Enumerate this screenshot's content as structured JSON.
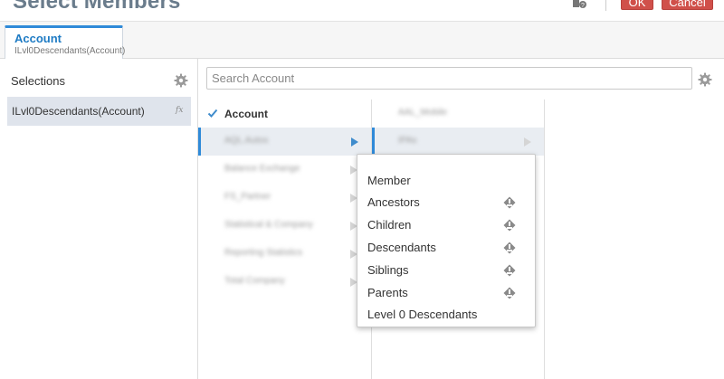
{
  "dialog": {
    "title": "Select Members",
    "ok_label": "OK",
    "cancel_label": "Cancel"
  },
  "tab": {
    "title": "Account",
    "subtitle": "ILvl0Descendants(Account)"
  },
  "selections": {
    "title": "Selections",
    "items": [
      {
        "label": "ILvl0Descendants(Account)",
        "badge": "fx"
      }
    ]
  },
  "search": {
    "placeholder": "Search Account",
    "value": ""
  },
  "members": {
    "root": "Account",
    "children": [
      "AQL.Autos",
      "Balance Exchange",
      "FS_Partner",
      "Statistical & Company",
      "Reporting Statistics",
      "Total Company"
    ],
    "selected_index": 0
  },
  "column2": {
    "items": [
      "AAL_Mobile",
      "IPAs"
    ]
  },
  "context_menu": {
    "items": [
      {
        "label": "Member",
        "icon": ""
      },
      {
        "label": "Ancestors",
        "icon": "hierarchy-icon"
      },
      {
        "label": "Children",
        "icon": "hierarchy-icon"
      },
      {
        "label": "Descendants",
        "icon": "hierarchy-icon"
      },
      {
        "label": "Siblings",
        "icon": "hierarchy-icon"
      },
      {
        "label": "Parents",
        "icon": "hierarchy-icon"
      },
      {
        "label": "Level 0 Descendants",
        "icon": ""
      }
    ]
  },
  "colors": {
    "accent": "#2f8ad8",
    "button": "#d0504a",
    "selection_bg": "#dfe4ec"
  }
}
